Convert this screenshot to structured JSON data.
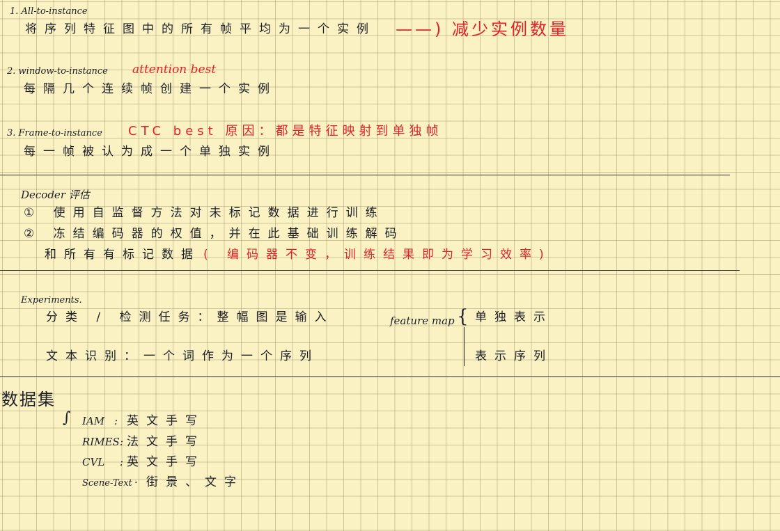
{
  "section1": {
    "title": "1. All-to-instance",
    "desc": "将序列特征图中的所有帧平均为一个实例",
    "note": "——) 减少实例数量"
  },
  "section2": {
    "title": "2. window-to-instance",
    "note": "attention best",
    "desc": "每隔几个连续帧创建一个实例"
  },
  "section3": {
    "title": "3. Frame-to-instance",
    "note": "CTC best 原因：都是特征映射到单独帧",
    "desc": "每一帧被认为成一个单独实例"
  },
  "decoder": {
    "title": "Decoder 评估",
    "item1": "① 使用自监督方法对未标记数据进行训练",
    "item2": "② 冻结编码器的权值，并在此基础训练解码",
    "item3_black": "和所有有标记数据",
    "item3_red": "( 编码器不变，训练结果即为学习效率)"
  },
  "experiments": {
    "title": "Experiments.",
    "row1": "分类 / 检测任务：整幅图是输入",
    "row2": "文本识别：一个词作为一个序列",
    "feature_map": "feature map",
    "fm_row1": "单独表示",
    "fm_row2": "表示序列"
  },
  "datasets": {
    "title": "数据集",
    "items": [
      {
        "name": "IAM",
        "sep": ":",
        "desc": "英文手写"
      },
      {
        "name": "RIMES",
        "sep": ":",
        "desc": "法文手写"
      },
      {
        "name": "CVL",
        "sep": ":",
        "desc": "英文手写"
      },
      {
        "name": "Scene-Text",
        "sep": "·",
        "desc": "街景、文字"
      }
    ]
  }
}
